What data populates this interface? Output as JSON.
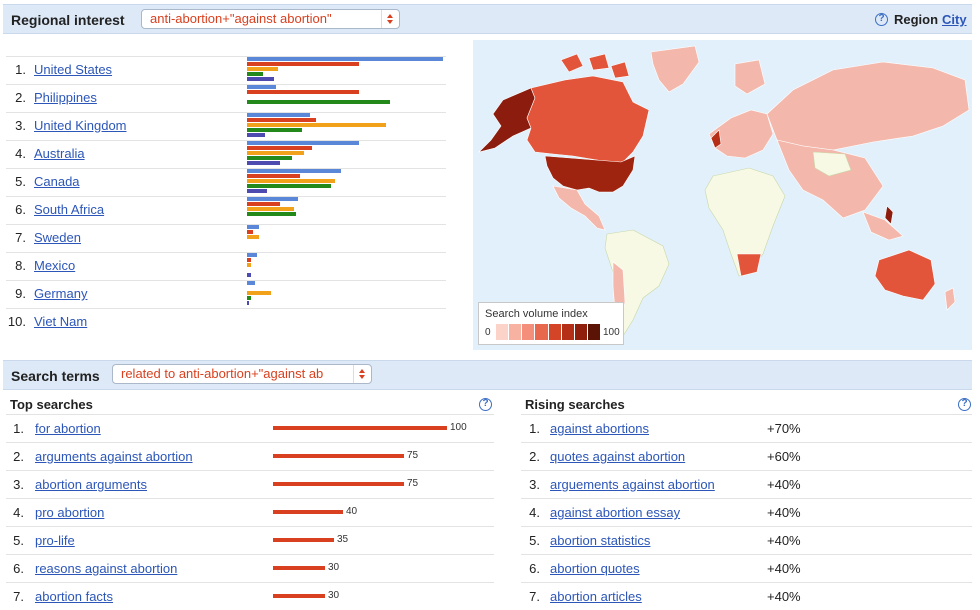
{
  "regional": {
    "title": "Regional interest",
    "query": "anti-abortion+\"against abortion\"",
    "region_label": "Region",
    "city_label": "City",
    "colors": {
      "series1": "#5b87d9",
      "series2": "#d8401f",
      "series3": "#f2a11b",
      "series4": "#23891b",
      "series5": "#4e4bb0"
    },
    "rows": [
      {
        "rank": "1.",
        "name": "United States",
        "bars": [
          1.0,
          0.57,
          0.16,
          0.08,
          0.14
        ]
      },
      {
        "rank": "2.",
        "name": "Philippines",
        "bars": [
          0.15,
          0.57,
          0.0,
          0.73,
          0.0
        ]
      },
      {
        "rank": "3.",
        "name": "United Kingdom",
        "bars": [
          0.32,
          0.35,
          0.71,
          0.28,
          0.09
        ]
      },
      {
        "rank": "4.",
        "name": "Australia",
        "bars": [
          0.57,
          0.33,
          0.29,
          0.23,
          0.17
        ]
      },
      {
        "rank": "5.",
        "name": "Canada",
        "bars": [
          0.48,
          0.27,
          0.45,
          0.43,
          0.1
        ]
      },
      {
        "rank": "6.",
        "name": "South Africa",
        "bars": [
          0.26,
          0.17,
          0.24,
          0.25,
          0.0
        ]
      },
      {
        "rank": "7.",
        "name": "Sweden",
        "bars": [
          0.06,
          0.03,
          0.06,
          0.0,
          0.0
        ]
      },
      {
        "rank": "8.",
        "name": "Mexico",
        "bars": [
          0.05,
          0.02,
          0.02,
          0.0,
          0.02
        ]
      },
      {
        "rank": "9.",
        "name": "Germany",
        "bars": [
          0.04,
          0.0,
          0.12,
          0.02,
          0.01
        ]
      },
      {
        "rank": "10.",
        "name": "Viet Nam",
        "bars": [
          0.0,
          0.0,
          0.0,
          0.0,
          0.0
        ]
      }
    ]
  },
  "map_legend": {
    "title": "Search volume index",
    "min": "0",
    "max": "100"
  },
  "search_terms": {
    "title": "Search terms",
    "query": "related to anti-abortion+\"against ab",
    "top": {
      "title": "Top searches",
      "rows": [
        {
          "rank": "1.",
          "term": "for abortion",
          "value": 100
        },
        {
          "rank": "2.",
          "term": "arguments against abortion",
          "value": 75
        },
        {
          "rank": "3.",
          "term": "abortion arguments",
          "value": 75
        },
        {
          "rank": "4.",
          "term": "pro abortion",
          "value": 40
        },
        {
          "rank": "5.",
          "term": "pro-life",
          "value": 35
        },
        {
          "rank": "6.",
          "term": "reasons against abortion",
          "value": 30
        },
        {
          "rank": "7.",
          "term": "abortion facts",
          "value": 30
        }
      ]
    },
    "rising": {
      "title": "Rising searches",
      "rows": [
        {
          "rank": "1.",
          "term": "against abortions",
          "change": "+70%"
        },
        {
          "rank": "2.",
          "term": "quotes against abortion",
          "change": "+60%"
        },
        {
          "rank": "3.",
          "term": "arguements against abortion",
          "change": "+40%"
        },
        {
          "rank": "4.",
          "term": "against abortion essay",
          "change": "+40%"
        },
        {
          "rank": "5.",
          "term": "abortion statistics",
          "change": "+40%"
        },
        {
          "rank": "6.",
          "term": "abortion quotes",
          "change": "+40%"
        },
        {
          "rank": "7.",
          "term": "abortion articles",
          "change": "+40%"
        }
      ]
    }
  }
}
